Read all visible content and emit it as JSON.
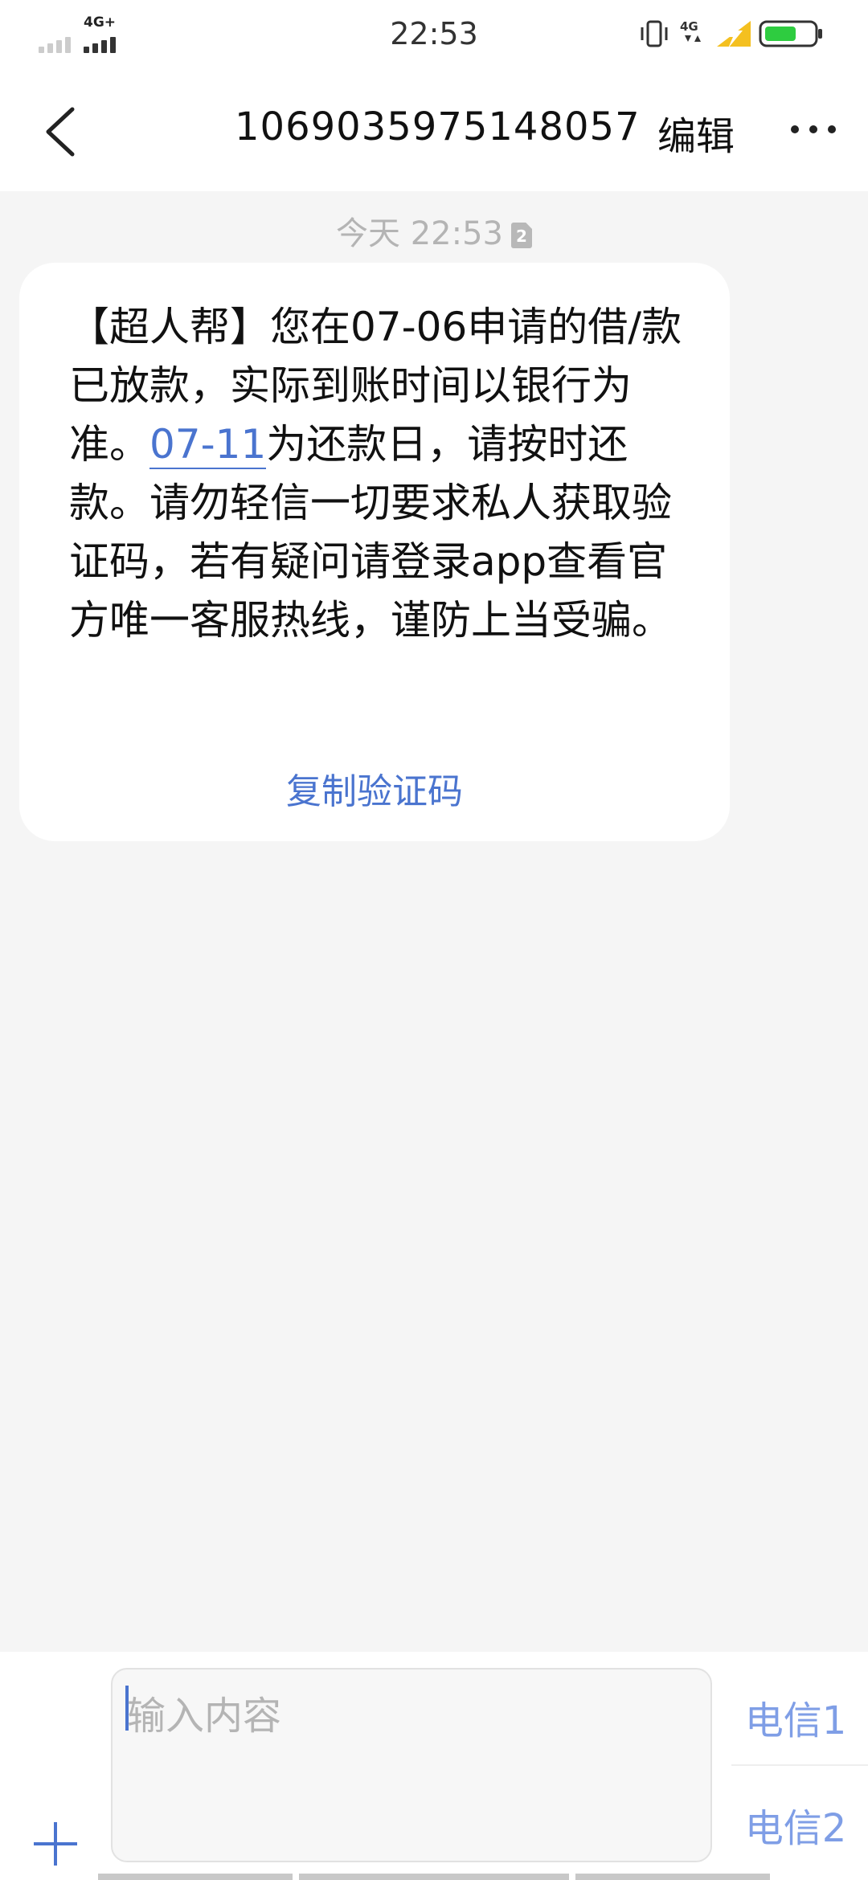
{
  "status_bar": {
    "time": "22:53",
    "network_left": "4G+",
    "network_right": "4G",
    "battery_color": "#2ecc40",
    "charging_color": "#f4c020"
  },
  "header": {
    "title": "1069035975148057",
    "edit_label": "编辑"
  },
  "conversation": {
    "timestamp": "今天 22:53",
    "sim_badge": "2",
    "message": {
      "text_before": "【超人帮】您在07-06申请的借/款已放款，实际到账时间以银行为准。",
      "link_text": "07-11",
      "text_after": "为还款日，请按时还款。请勿轻信一切要求私人获取验证码，若有疑问请登录app查看官方唯一客服热线，谨防上当受骗。",
      "copy_label": "复制验证码"
    }
  },
  "composer": {
    "placeholder": "输入内容",
    "sim1_label": "电信1",
    "sim2_label": "电信2"
  },
  "colors": {
    "accent": "#4a74cf",
    "sim_button": "#7f9ee6",
    "muted_text": "#b4b4b4",
    "background": "#f5f5f5"
  }
}
